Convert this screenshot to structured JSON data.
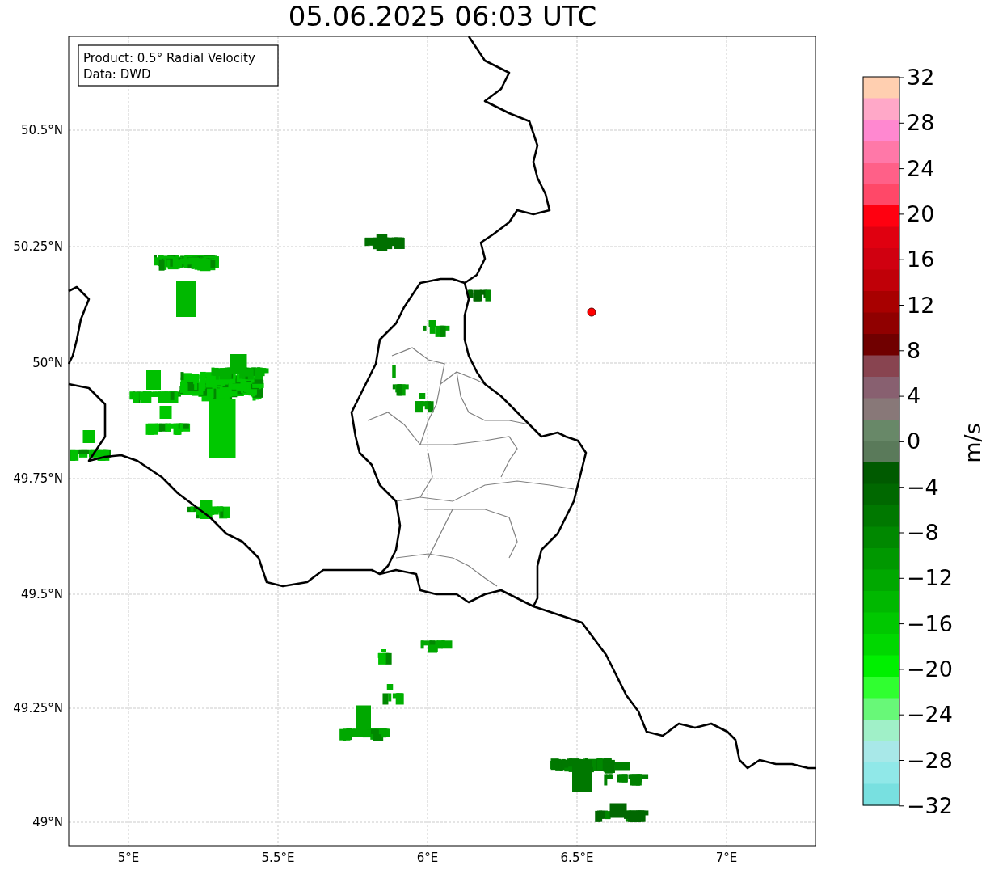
{
  "title": "05.06.2025 06:03 UTC",
  "info_box": {
    "lines": [
      "Product: 0.5° Radial Velocity",
      "Data: DWD"
    ]
  },
  "map": {
    "y_ticks": [
      "50.5°N",
      "50.25°N",
      "50°N",
      "49.75°N",
      "49.5°N",
      "49.25°N",
      "49°N"
    ],
    "x_ticks": [
      "5°E",
      "5.5°E",
      "6°E",
      "6.5°E",
      "7°E"
    ]
  },
  "colorbar": {
    "ticks": [
      "32",
      "28",
      "24",
      "20",
      "16",
      "12",
      "8",
      "4",
      "0",
      "−4",
      "−8",
      "−12",
      "−16",
      "−20",
      "−24",
      "−28",
      "−32"
    ],
    "label": "m/s"
  }
}
